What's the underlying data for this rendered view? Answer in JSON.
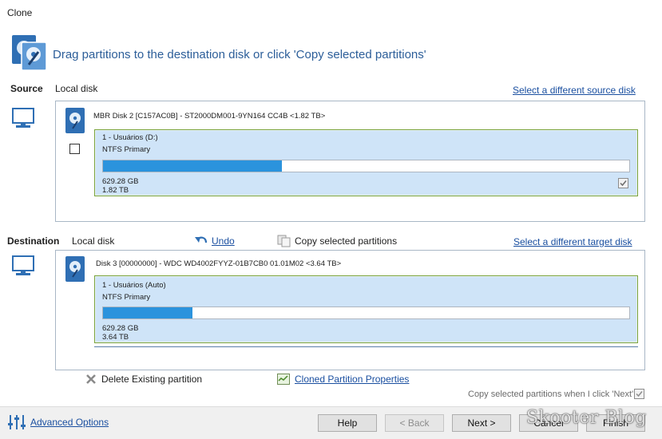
{
  "window": {
    "title": "Clone"
  },
  "header": {
    "instruction": "Drag partitions to the destination disk or click 'Copy selected partitions'"
  },
  "source": {
    "section_label": "Source",
    "disk_type": "Local disk",
    "change_link": "Select a different source disk",
    "disk_label": "MBR Disk 2 [C157AC0B] - ST2000DM001-9YN164 CC4B  <1.82 TB>",
    "partition": {
      "name": "1 - Usuários (D:)",
      "fs_type": "NTFS Primary",
      "used": "629.28 GB",
      "total": "1.82 TB",
      "used_fraction": 0.34
    }
  },
  "destination": {
    "section_label": "Destination",
    "disk_type": "Local disk",
    "undo_label": "Undo",
    "copy_label": "Copy selected partitions",
    "change_link": "Select a different target disk",
    "disk_label": "Disk 3 [00000000] - WDC WD4002FYYZ-01B7CB0 01.01M02  <3.64 TB>",
    "partition": {
      "name": "1 - Usuários (Auto)",
      "fs_type": "NTFS Primary",
      "used": "629.28 GB",
      "total": "3.64 TB",
      "used_fraction": 0.17
    }
  },
  "actions": {
    "delete_label": "Delete Existing partition",
    "properties_link": "Cloned Partition Properties",
    "copy_on_next_label": "Copy selected partitions when I click 'Next'"
  },
  "footer": {
    "advanced_link": "Advanced Options",
    "help": "Help",
    "back": "< Back",
    "next": "Next >",
    "cancel": "Cancel",
    "finish": "Finish",
    "watermark": "Skooter Blog"
  },
  "colors": {
    "accent": "#2b93dd",
    "partition_bg": "#cfe4f8",
    "partition_border": "#7aa33b",
    "link": "#1a4fa0"
  }
}
